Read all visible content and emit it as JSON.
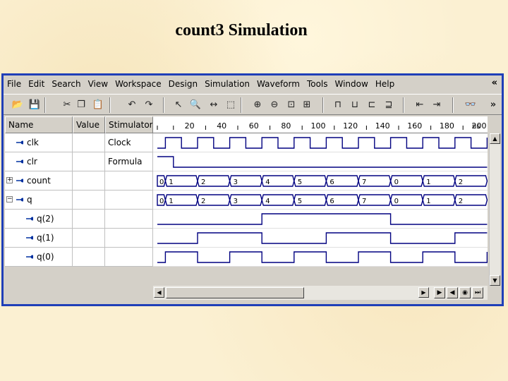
{
  "slide": {
    "title": "count3  Simulation"
  },
  "menu": [
    "File",
    "Edit",
    "Search",
    "View",
    "Workspace",
    "Design",
    "Simulation",
    "Waveform",
    "Tools",
    "Window",
    "Help"
  ],
  "menu_chevron": "«",
  "toolbar_chevron": "»",
  "toolbar_icons": [
    "open-folder-icon",
    "save-icon",
    "cut-icon",
    "copy-icon",
    "paste-icon",
    "undo-icon",
    "redo-icon",
    "pointer-icon",
    "zoom-icon",
    "measure-icon",
    "select-icon",
    "zoom-in-icon",
    "zoom-out-icon",
    "zoom-fit-icon",
    "zoom-range-icon",
    "edge-icon-1",
    "edge-icon-2",
    "edge-icon-3",
    "signal-icon",
    "prev-transition-icon",
    "next-transition-icon",
    "binoculars-icon"
  ],
  "columns": {
    "name": "Name",
    "value": "Value",
    "stimulator": "Stimulator"
  },
  "ruler": {
    "labels": [
      "20",
      "40",
      "60",
      "80",
      "100",
      "120",
      "140",
      "160",
      "180",
      "200"
    ],
    "unit": "ns"
  },
  "signals": [
    {
      "name": "clk",
      "value": "",
      "stimulator": "Clock",
      "kind": "clock",
      "expander": ""
    },
    {
      "name": "clr",
      "value": "",
      "stimulator": "Formula",
      "kind": "clr",
      "expander": ""
    },
    {
      "name": "count",
      "value": "",
      "stimulator": "",
      "kind": "bus",
      "expander": "+"
    },
    {
      "name": "q",
      "value": "",
      "stimulator": "",
      "kind": "bus",
      "expander": "−"
    },
    {
      "name": "q(2)",
      "value": "",
      "stimulator": "",
      "kind": "bit2",
      "expander": ""
    },
    {
      "name": "q(1)",
      "value": "",
      "stimulator": "",
      "kind": "bit1",
      "expander": ""
    },
    {
      "name": "q(0)",
      "value": "",
      "stimulator": "",
      "kind": "bit0",
      "expander": ""
    }
  ],
  "bus_values": [
    "0",
    "1",
    "2",
    "3",
    "4",
    "5",
    "6",
    "7",
    "0",
    "1",
    "2"
  ],
  "colors": {
    "frame": "#1f3fb8",
    "waveform": "#000080",
    "panel": "#d4d0c8"
  }
}
